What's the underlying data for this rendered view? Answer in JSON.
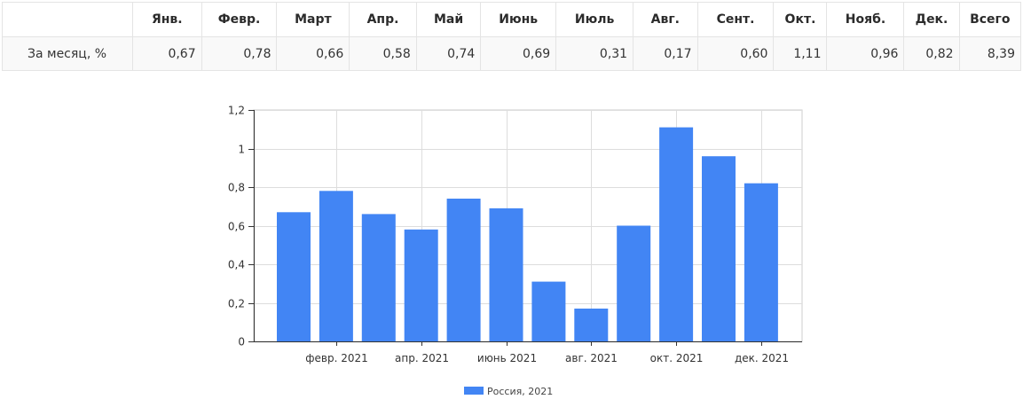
{
  "table": {
    "headers": [
      "",
      "Янв.",
      "Февр.",
      "Март",
      "Апр.",
      "Май",
      "Июнь",
      "Июль",
      "Авг.",
      "Сент.",
      "Окт.",
      "Нояб.",
      "Дек.",
      "Всего"
    ],
    "rows": [
      {
        "label": "За месяц, %",
        "values": [
          "0,67",
          "0,78",
          "0,66",
          "0,58",
          "0,74",
          "0,69",
          "0,31",
          "0,17",
          "0,60",
          "1,11",
          "0,96",
          "0,82",
          "8,39"
        ]
      }
    ]
  },
  "chart_data": {
    "type": "bar",
    "categories": [
      "янв. 2021",
      "февр. 2021",
      "март 2021",
      "апр. 2021",
      "май 2021",
      "июнь 2021",
      "июль 2021",
      "авг. 2021",
      "сент. 2021",
      "окт. 2021",
      "нояб. 2021",
      "дек. 2021"
    ],
    "x_tick_labels": [
      "февр. 2021",
      "апр. 2021",
      "июнь 2021",
      "авг. 2021",
      "окт. 2021",
      "дек. 2021"
    ],
    "x_tick_category_indices": [
      1,
      3,
      5,
      7,
      9,
      11
    ],
    "series": [
      {
        "name": "Россия, 2021",
        "color": "#4285f4",
        "values": [
          0.67,
          0.78,
          0.66,
          0.58,
          0.74,
          0.69,
          0.31,
          0.17,
          0.6,
          1.11,
          0.96,
          0.82
        ]
      }
    ],
    "y_ticks": [
      0,
      0.2,
      0.4,
      0.6,
      0.8,
      1,
      1.2
    ],
    "y_tick_labels": [
      "0",
      "0,2",
      "0,4",
      "0,6",
      "0,8",
      "1",
      "1,2"
    ],
    "ylim": [
      0,
      1.2
    ],
    "grid": true,
    "legend_position": "bottom",
    "title": "",
    "xlabel": "",
    "ylabel": ""
  }
}
